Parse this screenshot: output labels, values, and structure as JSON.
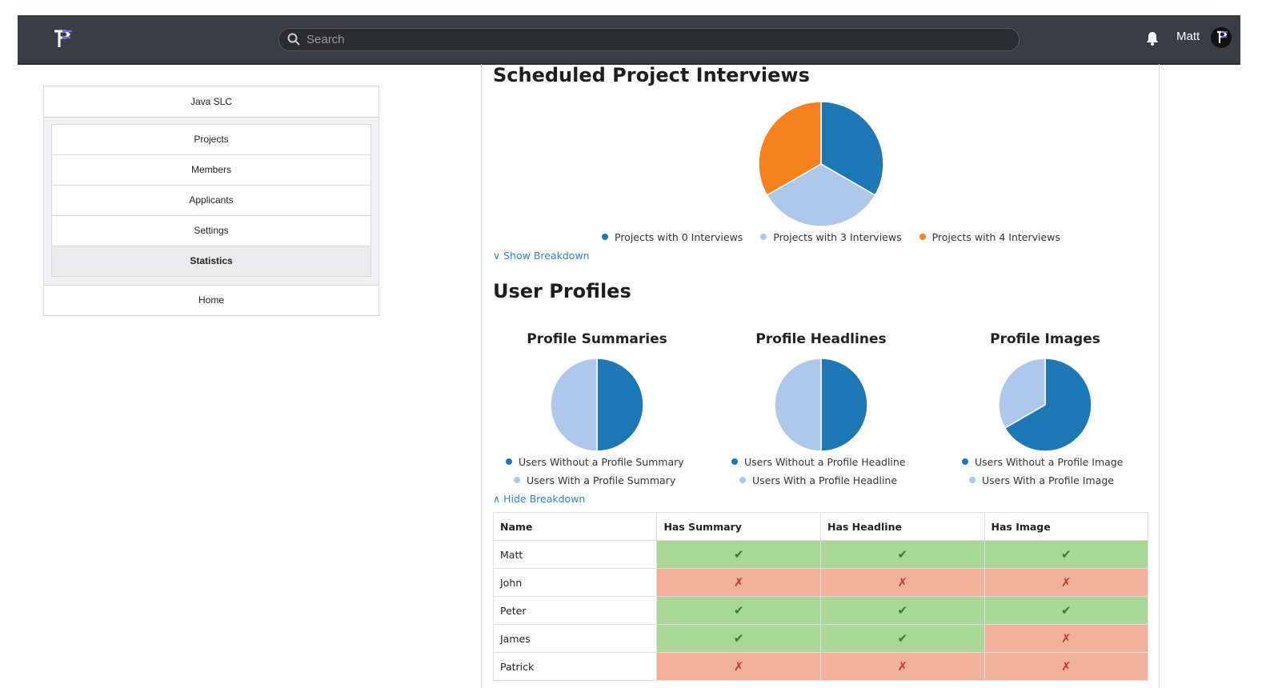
{
  "header": {
    "search_placeholder": "Search",
    "user_name": "Matt",
    "logo_icon": "pf-logo-icon",
    "bell_icon": "bell-icon"
  },
  "sidebar": {
    "org": "Java SLC",
    "items": [
      {
        "label": "Projects"
      },
      {
        "label": "Members"
      },
      {
        "label": "Applicants"
      },
      {
        "label": "Settings"
      },
      {
        "label": "Statistics",
        "active": true
      }
    ],
    "home": "Home"
  },
  "interviews": {
    "title": "Scheduled Project Interviews",
    "legend": [
      "Projects with 0 Interviews",
      "Projects with 3 Interviews",
      "Projects with 4 Interviews"
    ],
    "toggle": "Show Breakdown"
  },
  "profiles": {
    "title": "User Profiles",
    "toggle": "Hide Breakdown",
    "charts": [
      {
        "title": "Profile Summaries",
        "legend": [
          "Users Without a Profile Summary",
          "Users With a Profile Summary"
        ]
      },
      {
        "title": "Profile Headlines",
        "legend": [
          "Users Without a Profile Headline",
          "Users With a Profile Headline"
        ]
      },
      {
        "title": "Profile Images",
        "legend": [
          "Users Without a Profile Image",
          "Users With a Profile Image"
        ]
      }
    ],
    "table": {
      "headers": [
        "Name",
        "Has Summary",
        "Has Headline",
        "Has Image"
      ],
      "rows": [
        {
          "name": "Matt",
          "values": [
            true,
            true,
            true
          ]
        },
        {
          "name": "John",
          "values": [
            false,
            false,
            false
          ]
        },
        {
          "name": "Peter",
          "values": [
            true,
            true,
            true
          ]
        },
        {
          "name": "James",
          "values": [
            true,
            true,
            false
          ]
        },
        {
          "name": "Patrick",
          "values": [
            false,
            false,
            false
          ]
        }
      ]
    }
  },
  "colors": {
    "dark_blue": "#1f77b4",
    "light_blue": "#aec7e8",
    "orange": "#f5821f",
    "yes_cell": "#abd69a",
    "no_cell": "#efb09c",
    "link": "#3a80c6"
  },
  "chart_data": [
    {
      "type": "pie",
      "categories": [
        "Projects with 0 Interviews",
        "Projects with 3 Interviews",
        "Projects with 4 Interviews"
      ],
      "values": [
        1,
        1,
        1
      ],
      "colors": [
        "#1f77b4",
        "#aec7e8",
        "#f5821f"
      ]
    },
    {
      "type": "pie",
      "title": "Profile Summaries",
      "categories": [
        "Users Without a Profile Summary",
        "Users With a Profile Summary"
      ],
      "values": [
        1,
        1
      ],
      "colors": [
        "#1f77b4",
        "#aec7e8"
      ]
    },
    {
      "type": "pie",
      "title": "Profile Headlines",
      "categories": [
        "Users Without a Profile Headline",
        "Users With a Profile Headline"
      ],
      "values": [
        1,
        1
      ],
      "colors": [
        "#1f77b4",
        "#aec7e8"
      ]
    },
    {
      "type": "pie",
      "title": "Profile Images",
      "categories": [
        "Users Without a Profile Image",
        "Users With a Profile Image"
      ],
      "values": [
        2,
        1
      ],
      "colors": [
        "#1f77b4",
        "#aec7e8"
      ]
    }
  ]
}
